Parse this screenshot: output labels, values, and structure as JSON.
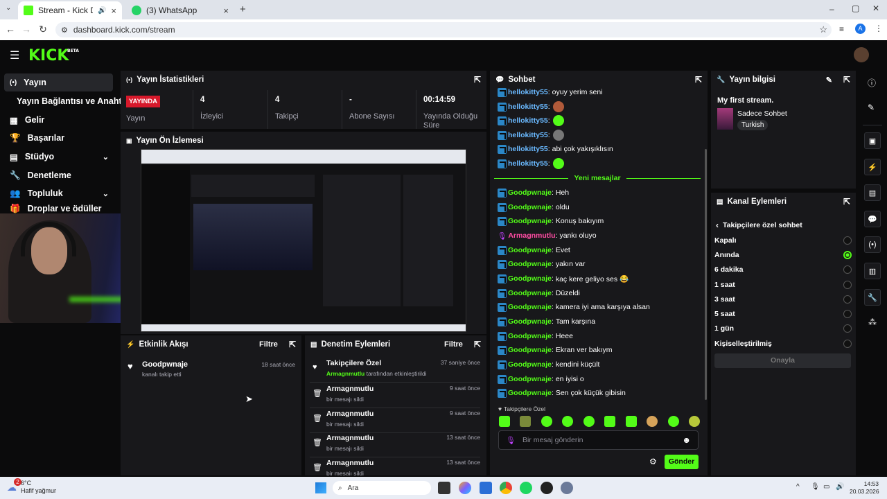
{
  "browser": {
    "tabs": [
      {
        "title": "Stream - Kick Dashboard",
        "active": true
      },
      {
        "title": "(3) WhatsApp",
        "active": false
      }
    ],
    "url": "dashboard.kick.com/stream",
    "profile_initial": "A"
  },
  "brand": {
    "logo": "KICK",
    "beta": "BETA",
    "accent": "#53fc18"
  },
  "sidebar": {
    "items": [
      {
        "label": "Yayın",
        "icon": "broadcast-icon"
      },
      {
        "label": "Yayın Bağlantısı ve Anahtarı",
        "icon": "none"
      },
      {
        "label": "Gelir",
        "icon": "revenue-icon"
      },
      {
        "label": "Başarılar",
        "icon": "trophy-icon"
      },
      {
        "label": "Stüdyo",
        "icon": "studio-icon"
      },
      {
        "label": "Denetleme",
        "icon": "wrench-icon"
      },
      {
        "label": "Topluluk",
        "icon": "community-icon"
      },
      {
        "label": "Droplar ve ödüller",
        "icon": "gift-icon"
      }
    ]
  },
  "stats": {
    "title": "Yayın İstatistikleri",
    "cells": [
      {
        "value": "YAYINDA",
        "label": "Yayın"
      },
      {
        "value": "4",
        "label": "İzleyici"
      },
      {
        "value": "4",
        "label": "Takipçi"
      },
      {
        "value": "-",
        "label": "Abone Sayısı"
      },
      {
        "value": "00:14:59",
        "label": "Yayında Olduğu Süre"
      }
    ]
  },
  "preview": {
    "title": "Yayın Ön İzlemesi"
  },
  "activity": {
    "title": "Etkinlik Akışı",
    "filter": "Filtre",
    "items": [
      {
        "user": "Goodpwnaje",
        "text": "kanalı takip etti",
        "time": "18 saat önce"
      }
    ]
  },
  "moderation": {
    "title": "Denetim Eylemleri",
    "filter": "Filtre",
    "items": [
      {
        "title": "Takipçilere Özel",
        "user": "Armagnmutlu",
        "sub": "tarafından etkinleştirildi",
        "time": "37 saniye önce",
        "icon": "heart-icon"
      },
      {
        "title": "Armagnmutlu",
        "sub": "bir mesajı sildi",
        "time": "9 saat önce",
        "icon": "trash-icon"
      },
      {
        "title": "Armagnmutlu",
        "sub": "bir mesajı sildi",
        "time": "9 saat önce",
        "icon": "trash-icon"
      },
      {
        "title": "Armagnmutlu",
        "sub": "bir mesajı sildi",
        "time": "13 saat önce",
        "icon": "trash-icon"
      },
      {
        "title": "Armagnmutlu",
        "sub": "bir mesajı sildi",
        "time": "13 saat önce",
        "icon": "trash-icon"
      }
    ]
  },
  "chat": {
    "title": "Sohbet",
    "new_messages": "Yeni mesajlar",
    "messages": [
      {
        "user": "hellokitty55",
        "text": "oyuy yerim seni",
        "color": "hello"
      },
      {
        "user": "hellokitty55",
        "text": "",
        "emote": true,
        "color": "hello"
      },
      {
        "user": "hellokitty55",
        "text": "",
        "emote": true,
        "color": "hello"
      },
      {
        "user": "hellokitty55",
        "text": "",
        "emote": true,
        "color": "hello"
      },
      {
        "user": "hellokitty55",
        "text": "abi çok yakışıklısın",
        "color": "hello"
      },
      {
        "user": "hellokitty55",
        "text": "",
        "emote": true,
        "color": "hello"
      },
      {
        "user": "Goodpwnaje",
        "text": "Heh",
        "color": "good"
      },
      {
        "user": "Goodpwnaje",
        "text": "oldu",
        "color": "good"
      },
      {
        "user": "Goodpwnaje",
        "text": "Konuş bakıyım",
        "color": "good"
      },
      {
        "user": "Armagnmutlu",
        "text": "yankı oluyo",
        "color": "arma"
      },
      {
        "user": "Goodpwnaje",
        "text": "Evet",
        "color": "good"
      },
      {
        "user": "Goodpwnaje",
        "text": "yakın var",
        "color": "good"
      },
      {
        "user": "Goodpwnaje",
        "text": "kaç kere geliyo ses 😂",
        "color": "good"
      },
      {
        "user": "Goodpwnaje",
        "text": "Düzeldi",
        "color": "good"
      },
      {
        "user": "Goodpwnaje",
        "text": "kamera iyi ama karşıya alsan",
        "color": "good"
      },
      {
        "user": "Goodpwnaje",
        "text": "Tam karşına",
        "color": "good"
      },
      {
        "user": "Goodpwnaje",
        "text": "Heee",
        "color": "good"
      },
      {
        "user": "Goodpwnaje",
        "text": "Ekran ver bakıym",
        "color": "good"
      },
      {
        "user": "Goodpwnaje",
        "text": "kendini küçült",
        "color": "good"
      },
      {
        "user": "Goodpwnaje",
        "text": "en iyisi o",
        "color": "good"
      },
      {
        "user": "Goodpwnaje",
        "text": "Sen çok küçük gibisin",
        "color": "good"
      }
    ],
    "followers_only": "Takipçilere Özel",
    "placeholder": "Bir mesaj gönderin",
    "send": "Gönder"
  },
  "stream_info": {
    "title": "Yayın bilgisi",
    "stream_title": "My first stream.",
    "category": "Sadece Sohbet",
    "tag": "Turkish"
  },
  "channel_actions": {
    "title": "Kanal Eylemleri",
    "subtitle": "Takipçilere özel sohbet",
    "options": [
      {
        "label": "Kapalı",
        "selected": false
      },
      {
        "label": "Anında",
        "selected": true
      },
      {
        "label": "6 dakika",
        "selected": false
      },
      {
        "label": "1 saat",
        "selected": false
      },
      {
        "label": "3 saat",
        "selected": false
      },
      {
        "label": "5 saat",
        "selected": false
      },
      {
        "label": "1 gün",
        "selected": false
      },
      {
        "label": "Kişiselleştirilmiş",
        "selected": false
      }
    ],
    "confirm": "Onayla"
  },
  "taskbar": {
    "weather_temp": "6°C",
    "weather_text": "Hafif yağmur",
    "weather_badge": "2",
    "search": "Ara",
    "time": "14:53",
    "date": "20.03.2026"
  }
}
